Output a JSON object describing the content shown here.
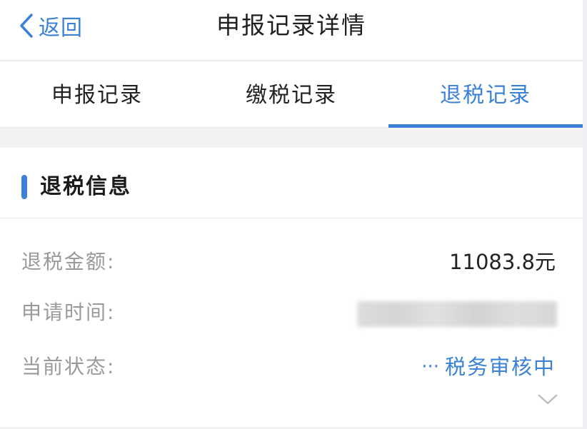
{
  "nav": {
    "back_label": "返回",
    "title": "申报记录详情"
  },
  "tabs": [
    {
      "label": "申报记录",
      "active": false
    },
    {
      "label": "缴税记录",
      "active": false
    },
    {
      "label": "退税记录",
      "active": true
    }
  ],
  "section": {
    "title": "退税信息",
    "rows": [
      {
        "label": "退税金额:",
        "value": "11083.8元"
      },
      {
        "label": "申请时间:",
        "value": ""
      },
      {
        "label": "当前状态:",
        "value": "税务审核中",
        "prefix": "···"
      }
    ]
  },
  "colors": {
    "accent": "#3b82d6",
    "label_gray": "#9a9a9a"
  },
  "icons": {
    "back": "chevron-left-icon",
    "expand": "chevron-down-icon",
    "status": "ellipsis-icon"
  }
}
